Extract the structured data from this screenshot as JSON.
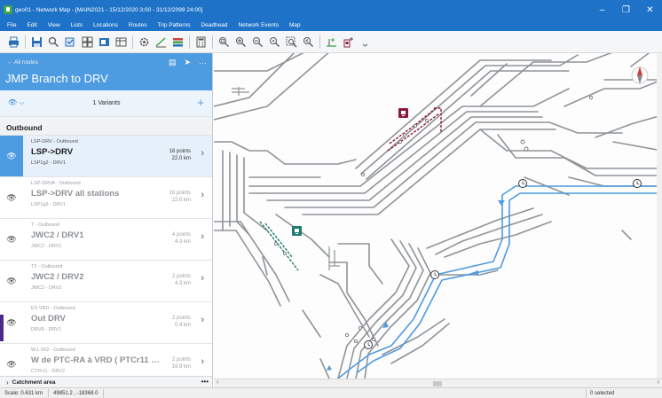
{
  "window": {
    "title": "geo01 - Network Map - [MAIN2021 - 15/12/2020 3:00 - 31/12/2099 24:00]",
    "controls": {
      "minimize": "–",
      "maximize": "❐",
      "close": "✕"
    }
  },
  "menu": [
    "File",
    "Edit",
    "View",
    "Lists",
    "Locations",
    "Routes",
    "Trip Patterns",
    "Deadhead",
    "Network Events",
    "Map"
  ],
  "panel": {
    "back_label": "All routes",
    "title": "JMP Branch to DRV",
    "variants_label": "1 Variants",
    "section": "Outbound",
    "routes": [
      {
        "sub": "LSP-DRV - Outbound",
        "name": "LSP->DRV",
        "code": "LSP1g2 - DRV1",
        "points": "16 points",
        "km": "22.0 km",
        "selected": true
      },
      {
        "sub": "LSP-DRVA - Outbound",
        "name": "LSP->DRV all stations",
        "code": "LSP1g2 - DRV1",
        "points": "16 points",
        "km": "22.0 km",
        "selected": false
      },
      {
        "sub": "T - Outbound",
        "name": "JWC2 / DRV1",
        "code": "JWC2 - DRV1",
        "points": "4 points",
        "km": "4.3 km",
        "selected": false
      },
      {
        "sub": "T2 - Outbound",
        "name": "JWC2 / DRV2",
        "code": "JWC2 - DRV2",
        "points": "2 points",
        "km": "4.3 km",
        "selected": false
      },
      {
        "sub": "ES VRD - Outbound",
        "name": "Out DRV",
        "code": "DRV8 - DRV1",
        "points": "2 points",
        "km": "0.4 km",
        "selected": false
      },
      {
        "sub": "W-L 002 - Outbound",
        "name": "W de PTC-RA à VRD ( PTCr11 à VR...",
        "code": "CTPr11 - DRV2",
        "points": "2 points",
        "km": "19.9 km",
        "selected": false
      }
    ],
    "footer_label": "Catchment area",
    "footer_more": "•••"
  },
  "status": {
    "scale": "Scale: 0.631 km",
    "coords": "49851.2 , -18368.0",
    "selection": "0 selected"
  },
  "icons": {
    "back": "arrow-left-icon",
    "eye": "eye-icon",
    "chevron": "chevron-right-icon",
    "compass": "compass-icon",
    "clock": "clock-icon",
    "station": "station-icon"
  },
  "colors": {
    "titlebar": "#1e73c9",
    "panel_header": "#4d9be0",
    "route_blue": "#4d9be0",
    "selected_route": "#8b1a3a",
    "secondary_route": "#1f7a70",
    "tracks": "#8f9499"
  }
}
